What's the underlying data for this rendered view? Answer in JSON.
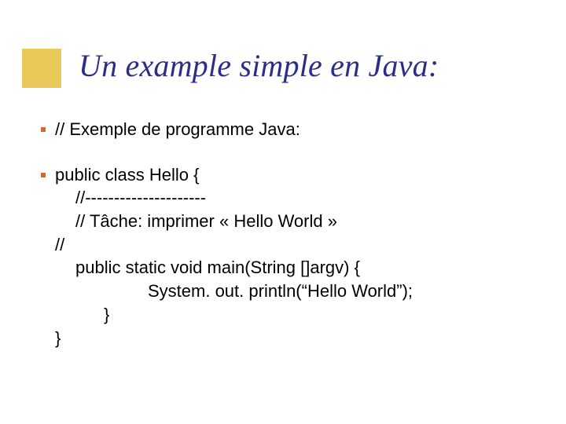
{
  "title": "Un example simple en Java:",
  "lines": {
    "l1": "// Exemple de programme Java:",
    "l2": "public class Hello {",
    "l3": "//---------------------",
    "l4": "// Tâche: imprimer « Hello World »",
    "l5": "//",
    "l6": "public static void main(String []argv) {",
    "l7": "System. out. println(“Hello World”);",
    "l8": "}",
    "l9": "}"
  }
}
